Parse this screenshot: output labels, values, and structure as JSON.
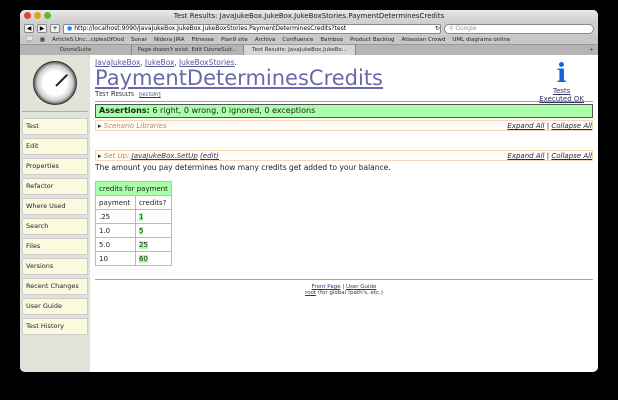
{
  "window": {
    "title": "Test Results: JavaJukeBox.JukeBox.JukeBoxStories.PaymentDeterminesCredits"
  },
  "toolbar": {
    "back": "◀",
    "forward": "▶",
    "add": "+",
    "url": "http://localhost:9090/JavaJukeBox.JukeBox.JukeBoxStories.PaymentDeterminesCredits?test",
    "reload": "↻",
    "search_placeholder": "Google"
  },
  "bookmarks": [
    "ArticleS.Unc...ciplesOfOod",
    "Sonar",
    "Nidera JIRA",
    "Fitnesse",
    "Plan9 site",
    "Archiva",
    "Confluence",
    "Bamboo",
    "Product Backlog",
    "Atlassian Crowd",
    "UML diagrams online"
  ],
  "tabs": [
    "DzoneSuite",
    "Page doesn't exist. Edit DzoneSuit...",
    "Test Results: JavaJukeBox.JukeBo..."
  ],
  "new_tab": "+",
  "sidebar": {
    "items": [
      "Test",
      "Edit",
      "Properties",
      "Refactor",
      "Where Used",
      "Search",
      "Files",
      "Versions",
      "Recent Changes",
      "User Guide",
      "Test History"
    ]
  },
  "page": {
    "breadcrumbs": [
      "JavaJukeBox",
      "JukeBox",
      "JukeBoxStories"
    ],
    "title": "PaymentDeterminesCredits",
    "subtitle": "Test Results",
    "history": "[history]",
    "status": {
      "line1": "Tests",
      "line2": "Executed OK"
    },
    "assertions_label": "Assertions:",
    "assertions_text": "6 right, 0 wrong, 0 ignored, 0 exceptions",
    "scenario": "Scenario Libraries",
    "expand_all": "Expand All",
    "collapse_all": "Collapse All",
    "sep": "|",
    "setup_label": "Set Up:",
    "setup_link": "JavaJukeBox.SetUp",
    "setup_edit": "(edit)",
    "description": "The amount you pay determines how many credits get added to your balance.",
    "table": {
      "title": "credits for payment",
      "headers": [
        "payment",
        "credits?"
      ],
      "rows": [
        [
          ".25",
          "1"
        ],
        [
          "1.0",
          "5"
        ],
        [
          "5.0",
          "25"
        ],
        [
          "10",
          "60"
        ]
      ]
    },
    "footer": {
      "front_page": "Front Page",
      "user_guide": "User Guide",
      "root": "root",
      "root_note": "(for global !path's, etc.)"
    }
  }
}
